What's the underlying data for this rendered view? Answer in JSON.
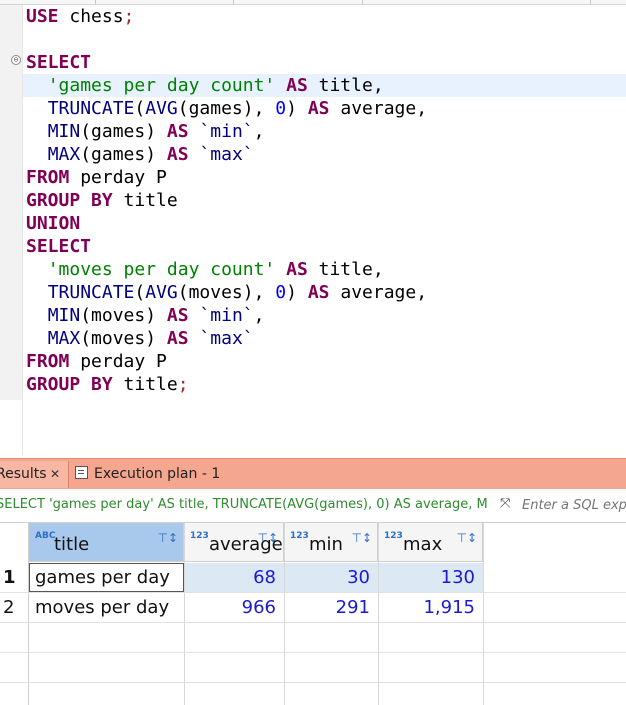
{
  "editor": {
    "lines": [
      [
        {
          "t": "USE",
          "c": "kw"
        },
        {
          "t": " chess",
          "c": ""
        },
        {
          "t": ";",
          "c": "semi"
        }
      ],
      [],
      [
        {
          "t": "SELECT",
          "c": "kw"
        }
      ],
      [
        {
          "t": "  ",
          "c": ""
        },
        {
          "t": "'games per day count'",
          "c": "str"
        },
        {
          "t": " ",
          "c": ""
        },
        {
          "t": "AS",
          "c": "kw"
        },
        {
          "t": " title,",
          "c": ""
        }
      ],
      [
        {
          "t": "  ",
          "c": ""
        },
        {
          "t": "TRUNCATE",
          "c": "fn"
        },
        {
          "t": "(",
          "c": ""
        },
        {
          "t": "AVG",
          "c": "fn"
        },
        {
          "t": "(games), ",
          "c": ""
        },
        {
          "t": "0",
          "c": "num"
        },
        {
          "t": ") ",
          "c": ""
        },
        {
          "t": "AS",
          "c": "kw"
        },
        {
          "t": " average,",
          "c": ""
        }
      ],
      [
        {
          "t": "  ",
          "c": ""
        },
        {
          "t": "MIN",
          "c": "fn"
        },
        {
          "t": "(games) ",
          "c": ""
        },
        {
          "t": "AS",
          "c": "kw"
        },
        {
          "t": " ",
          "c": ""
        },
        {
          "t": "`min`",
          "c": "bq"
        },
        {
          "t": ",",
          "c": ""
        }
      ],
      [
        {
          "t": "  ",
          "c": ""
        },
        {
          "t": "MAX",
          "c": "fn"
        },
        {
          "t": "(games) ",
          "c": ""
        },
        {
          "t": "AS",
          "c": "kw"
        },
        {
          "t": " ",
          "c": ""
        },
        {
          "t": "`max`",
          "c": "bq"
        }
      ],
      [
        {
          "t": "FROM",
          "c": "kw"
        },
        {
          "t": " perday P",
          "c": ""
        }
      ],
      [
        {
          "t": "GROUP BY",
          "c": "kw"
        },
        {
          "t": " title",
          "c": ""
        }
      ],
      [
        {
          "t": "UNION",
          "c": "kw"
        }
      ],
      [
        {
          "t": "SELECT",
          "c": "kw"
        }
      ],
      [
        {
          "t": "  ",
          "c": ""
        },
        {
          "t": "'moves per day count'",
          "c": "str"
        },
        {
          "t": " ",
          "c": ""
        },
        {
          "t": "AS",
          "c": "kw"
        },
        {
          "t": " title,",
          "c": ""
        }
      ],
      [
        {
          "t": "  ",
          "c": ""
        },
        {
          "t": "TRUNCATE",
          "c": "fn"
        },
        {
          "t": "(",
          "c": ""
        },
        {
          "t": "AVG",
          "c": "fn"
        },
        {
          "t": "(moves), ",
          "c": ""
        },
        {
          "t": "0",
          "c": "num"
        },
        {
          "t": ") ",
          "c": ""
        },
        {
          "t": "AS",
          "c": "kw"
        },
        {
          "t": " average,",
          "c": ""
        }
      ],
      [
        {
          "t": "  ",
          "c": ""
        },
        {
          "t": "MIN",
          "c": "fn"
        },
        {
          "t": "(moves) ",
          "c": ""
        },
        {
          "t": "AS",
          "c": "kw"
        },
        {
          "t": " ",
          "c": ""
        },
        {
          "t": "`min`",
          "c": "bq"
        },
        {
          "t": ",",
          "c": ""
        }
      ],
      [
        {
          "t": "  ",
          "c": ""
        },
        {
          "t": "MAX",
          "c": "fn"
        },
        {
          "t": "(moves) ",
          "c": ""
        },
        {
          "t": "AS",
          "c": "kw"
        },
        {
          "t": " ",
          "c": ""
        },
        {
          "t": "`max`",
          "c": "bq"
        }
      ],
      [
        {
          "t": "FROM",
          "c": "kw"
        },
        {
          "t": " perday P",
          "c": ""
        }
      ],
      [
        {
          "t": "GROUP BY",
          "c": "kw"
        },
        {
          "t": " title",
          "c": ""
        },
        {
          "t": ";",
          "c": "semi"
        }
      ]
    ],
    "fold_symbol": "⊖"
  },
  "results_panel": {
    "tabs": [
      {
        "label": "Results",
        "close": "✕",
        "active": true
      },
      {
        "label": "Execution plan - 1",
        "icon": "execution-plan-icon",
        "active": false
      }
    ],
    "query_text": "SELECT 'games per day' AS title, TRUNCATE(AVG(games), 0) AS average, M",
    "expand_icon": "⤧",
    "filter_placeholder": "Enter a SQL expression to filter results"
  },
  "grid": {
    "type_badge_text": "ABC",
    "type_badge_num": "123",
    "sort_icon": "⊤↕",
    "columns": [
      {
        "name": "title",
        "type": "ABC"
      },
      {
        "name": "average",
        "type": "123"
      },
      {
        "name": "min",
        "type": "123"
      },
      {
        "name": "max",
        "type": "123"
      }
    ],
    "rows": [
      {
        "num": "1",
        "title": "games per day",
        "average": "68",
        "min": "30",
        "max": "130"
      },
      {
        "num": "2",
        "title": "moves per day",
        "average": "966",
        "min": "291",
        "max": "1,915"
      }
    ]
  },
  "colors": {
    "keyword": "#7f0055",
    "string": "#008000",
    "number": "#0000ff",
    "results_tab_bar": "#f4a68e",
    "selected_header": "#a9c9ec"
  }
}
